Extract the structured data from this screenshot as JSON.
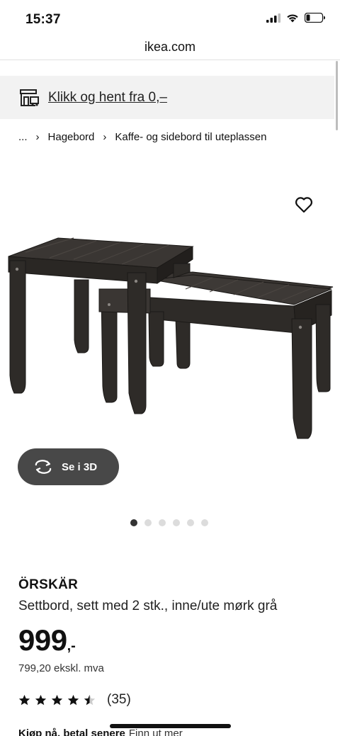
{
  "status": {
    "time": "15:37"
  },
  "browser": {
    "url": "ikea.com"
  },
  "banner": {
    "text": "Klikk og hent fra 0,–",
    "icon": "store-icon"
  },
  "breadcrumb": {
    "ellipsis": "...",
    "items": [
      "Hagebord",
      "Kaffe- og sidebord til uteplassen"
    ],
    "separator": "›"
  },
  "gallery": {
    "view_3d_label": "Se i 3D",
    "image_count": 6,
    "active_index": 0
  },
  "product": {
    "name": "ÖRSKÄR",
    "description": "Settbord, sett med 2 stk., inne/ute mørk grå",
    "price_main": "999",
    "price_suffix": ",-",
    "price_ex_vat": "799,20 ekskl. mva",
    "rating": 4.5,
    "review_count": "(35)"
  },
  "pay_later": {
    "bold": "Kjøp nå, betal senere",
    "link": "Finn ut mer"
  },
  "colors": {
    "view3d_bg": "#484848",
    "banner_bg": "#f2f2f2",
    "furniture": "#2e2b28"
  }
}
